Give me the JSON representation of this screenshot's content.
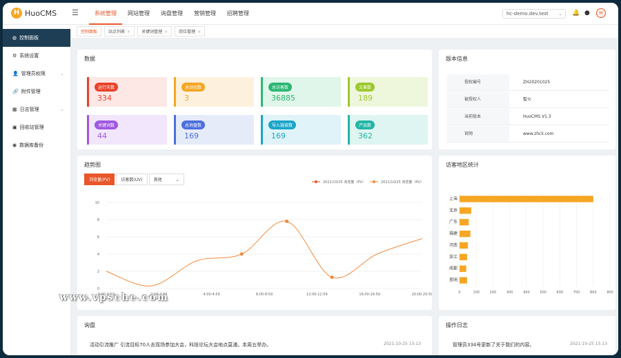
{
  "app": {
    "name": "HuoCMS",
    "logo_letter": "H"
  },
  "top_nav": [
    "系统管理",
    "网站管理",
    "询盘管理",
    "营销管理",
    "招聘管理"
  ],
  "domain_select": "hc-demo.dev.test",
  "sidebar": [
    {
      "label": "控制面板",
      "icon": "dashboard-icon"
    },
    {
      "label": "系统设置",
      "icon": "gear-icon"
    },
    {
      "label": "管理员权限",
      "icon": "user-icon"
    },
    {
      "label": "附件管理",
      "icon": "paperclip-icon"
    },
    {
      "label": "日志管理",
      "icon": "calendar-icon"
    },
    {
      "label": "回收站管理",
      "icon": "trash-icon"
    },
    {
      "label": "数据库备份",
      "icon": "database-icon"
    }
  ],
  "tabs": [
    "控制面板",
    "站点列表",
    "关键词管理",
    "岗位管理"
  ],
  "data_panel": {
    "title": "数据",
    "stats": [
      {
        "label": "运行天数",
        "value": "334",
        "color": "#e8432a",
        "bg": "#fde8e6"
      },
      {
        "label": "总动态数",
        "value": "3",
        "color": "#f5a623",
        "bg": "#fdf1de"
      },
      {
        "label": "总访客数",
        "value": "36885",
        "color": "#2bb673",
        "bg": "#e1f6ea"
      },
      {
        "label": "文章数",
        "value": "189",
        "color": "#9bc82c",
        "bg": "#eef6dc"
      },
      {
        "label": "关键词数",
        "value": "44",
        "color": "#a057e0",
        "bg": "#f1e6fb"
      },
      {
        "label": "总询盘数",
        "value": "169",
        "color": "#4a6fdc",
        "bg": "#e6ebfa"
      },
      {
        "label": "导入链接数",
        "value": "169",
        "color": "#1aa5c8",
        "bg": "#dff3f8"
      },
      {
        "label": "产品数",
        "value": "362",
        "color": "#22b5a5",
        "bg": "#dff5f1"
      }
    ]
  },
  "version_panel": {
    "title": "版本信息",
    "rows": [
      {
        "k": "授权编号",
        "v": "ZH20201025"
      },
      {
        "k": "被授权人",
        "v": "智火"
      },
      {
        "k": "当前版本",
        "v": "HuoCMS V1.3"
      },
      {
        "k": "官网",
        "v": "www.zhcli.com"
      }
    ]
  },
  "trend_panel": {
    "title": "趋势图",
    "buttons": [
      "浏览量(PV)",
      "访客数(UV)",
      "其他"
    ]
  },
  "region_panel": {
    "title": "访客地区统计"
  },
  "inquiry_panel": {
    "title": "询盘",
    "item_text": "活动引流推广 引流目标70人去现场参加大会，科技论坛大会地点莫浦，本周五举办。",
    "item_time": "2021-10-25 15:13"
  },
  "log_panel": {
    "title": "操作日志",
    "item_text": "管理员334号更新了关于我们的内容。",
    "item_time": "2021-10-25 15:13"
  },
  "watermark": "www.vpsche.com",
  "chart_data": [
    {
      "type": "line",
      "title": "趋势图",
      "series": [
        {
          "name": "2021/10/25 浏览量（PV）",
          "color": "#e8562a"
        },
        {
          "name": "2021/10/25 浏览量（PV）",
          "color": "#f08a3c",
          "x": [
            0,
            1,
            2,
            3,
            4,
            5,
            6,
            7
          ],
          "values": [
            2,
            0.3,
            3.2,
            4,
            7.8,
            1.3,
            4,
            5.8
          ]
        }
      ],
      "xtick_labels": [
        "0:00-0:59",
        "2:00-2:59",
        "4:00-4:59",
        "8:00-8:59",
        "12:00-12:59",
        "16:00-16:59",
        "20:00-20:59"
      ],
      "marker_indices": [
        3,
        4,
        5
      ],
      "yticks": [
        0,
        2,
        4,
        6,
        8,
        10
      ],
      "ylim": [
        0,
        10
      ],
      "grid": true,
      "legend": "top-right"
    },
    {
      "type": "bar",
      "orientation": "horizontal",
      "title": "访客地区统计",
      "categories": [
        "上海",
        "北京",
        "广东",
        "福建",
        "河南",
        "浙江",
        "成都",
        "昆明"
      ],
      "values": [
        800,
        70,
        55,
        65,
        50,
        45,
        40,
        45
      ],
      "xticks": [
        0,
        100,
        200,
        300,
        400,
        500,
        600,
        700,
        800,
        900
      ],
      "xlim": [
        0,
        900
      ],
      "color": "#f5a623"
    }
  ]
}
